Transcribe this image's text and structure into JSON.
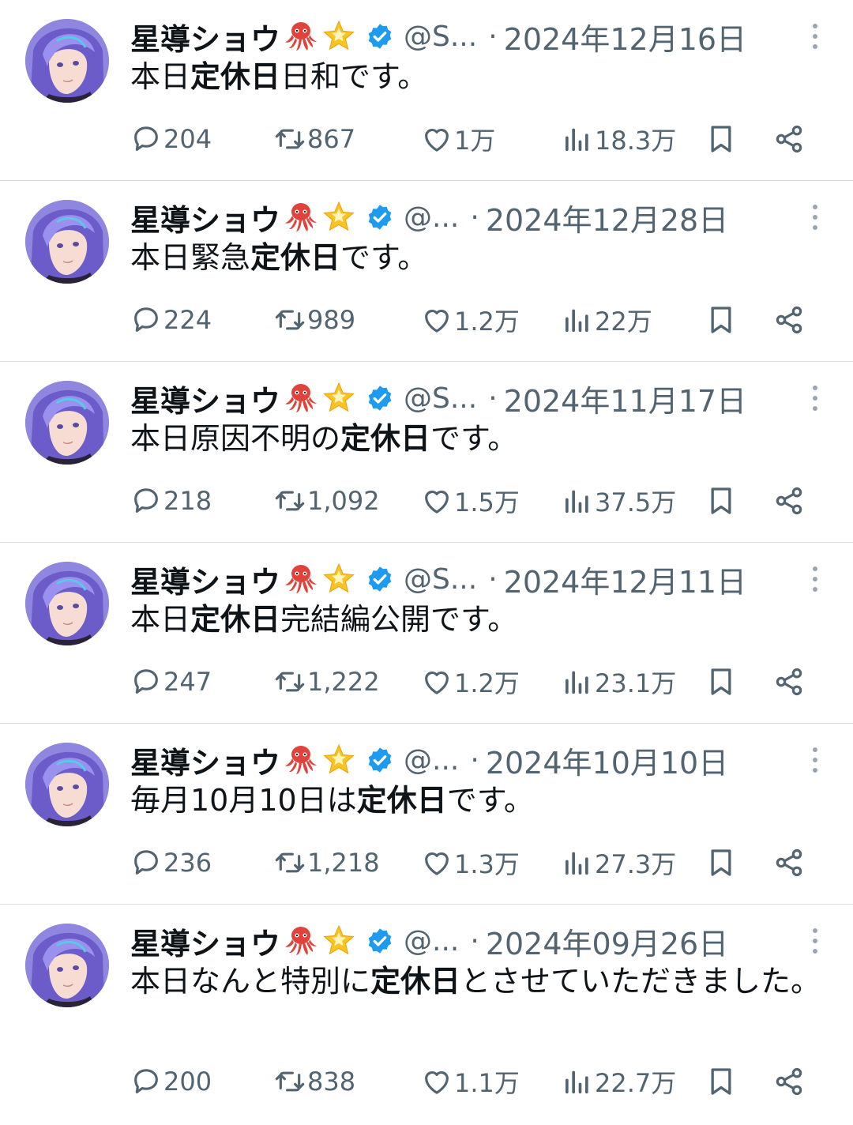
{
  "colors": {
    "secondary": "#536471",
    "verified": "#1d9bf0",
    "divider": "#d9dde1"
  },
  "icons": {
    "reply": "speech-bubble-icon",
    "retweet": "retweet-icon",
    "like": "heart-icon",
    "views": "bar-chart-icon",
    "bookmark": "bookmark-icon",
    "share": "share-icon",
    "more": "vertical-dots-icon",
    "emoji1": "octopus-emoji",
    "emoji2": "glowing-star-emoji",
    "badge": "verified-badge-icon"
  },
  "tweets": [
    {
      "name": "星導ショウ",
      "handle": "@S...",
      "date": "2024年12月16日",
      "text_pre": "本日",
      "text_bold": "定休日",
      "text_post": "日和です。",
      "replies": "204",
      "retweets": "867",
      "likes": "1万",
      "views": "18.3万"
    },
    {
      "name": "星導ショウ",
      "handle": "@...",
      "date": "2024年12月28日",
      "text_pre": "本日緊急",
      "text_bold": "定休日",
      "text_post": "です。",
      "replies": "224",
      "retweets": "989",
      "likes": "1.2万",
      "views": "22万"
    },
    {
      "name": "星導ショウ",
      "handle": "@S...",
      "date": "2024年11月17日",
      "text_pre": "本日原因不明の",
      "text_bold": "定休日",
      "text_post": "です。",
      "replies": "218",
      "retweets": "1,092",
      "likes": "1.5万",
      "views": "37.5万"
    },
    {
      "name": "星導ショウ",
      "handle": "@S...",
      "date": "2024年12月11日",
      "text_pre": "本日",
      "text_bold": "定休日",
      "text_post": "完結編公開です。",
      "replies": "247",
      "retweets": "1,222",
      "likes": "1.2万",
      "views": "23.1万"
    },
    {
      "name": "星導ショウ",
      "handle": "@...",
      "date": "2024年10月10日",
      "text_pre": "毎月10月10日は",
      "text_bold": "定休日",
      "text_post": "です。",
      "replies": "236",
      "retweets": "1,218",
      "likes": "1.3万",
      "views": "27.3万"
    },
    {
      "name": "星導ショウ",
      "handle": "@...",
      "date": "2024年09月26日",
      "text_pre": "本日なんと特別に",
      "text_bold": "定休日",
      "text_post": "とさせていただきました。",
      "replies": "200",
      "retweets": "838",
      "likes": "1.1万",
      "views": "22.7万"
    }
  ]
}
